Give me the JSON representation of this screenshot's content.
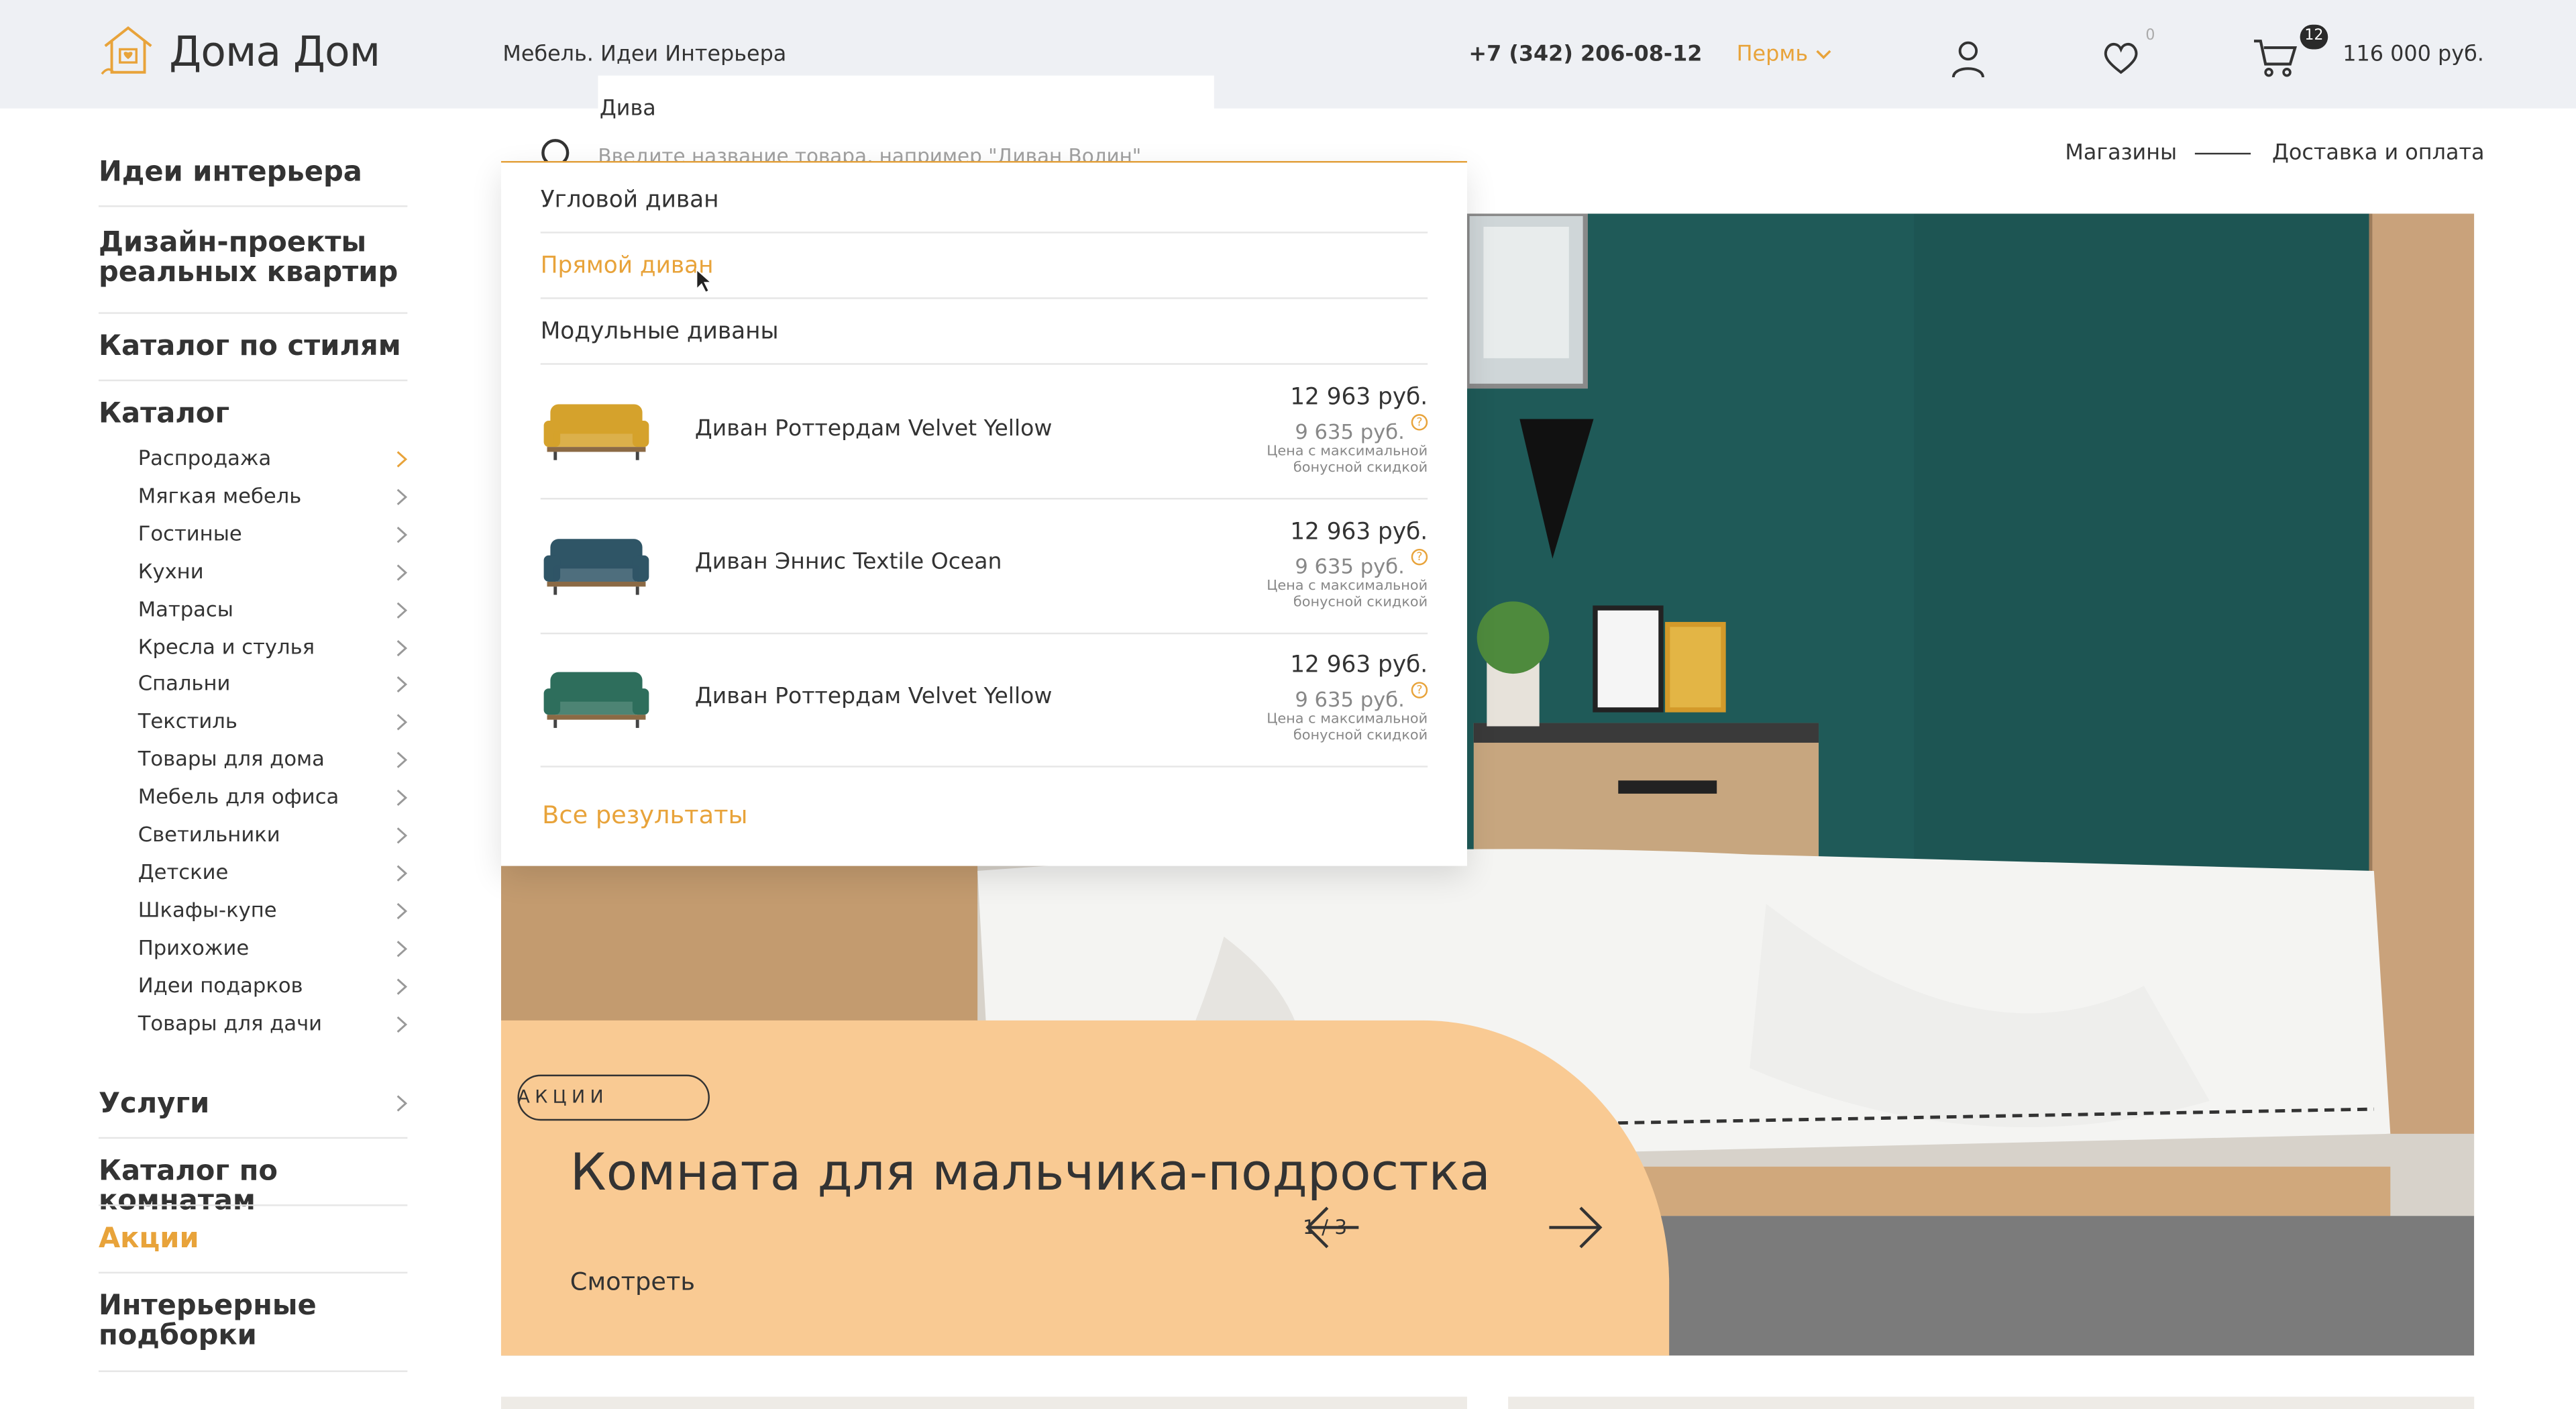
{
  "header": {
    "logo_text": "Дома Дом",
    "tagline": "Мебель. Идеи Интерьера",
    "phone": "+7 (342) 206-08-12",
    "city": "Пермь",
    "favorites_count": "0",
    "cart_count": "12",
    "cart_total": "116 000 руб."
  },
  "search": {
    "typed_text": "Дива",
    "placeholder": "Введите название товара, например \"Диван Волин\""
  },
  "dropdown": {
    "queries": [
      {
        "label": "Угловой диван"
      },
      {
        "label": "Прямой диван"
      },
      {
        "label": "Модульные диваны"
      }
    ],
    "products": [
      {
        "name": "Диван Роттердам Velvet Yellow",
        "price": "12 963 руб.",
        "bonus_price": "9 635 руб.",
        "note": "Цена с максимальной бонусной скидкой",
        "color": "#d5a22c"
      },
      {
        "name": "Диван Эннис Textile Ocean",
        "price": "12 963 руб.",
        "bonus_price": "9 635 руб.",
        "note": "Цена с максимальной бонусной скидкой",
        "color": "#2f5566"
      },
      {
        "name": "Диван Роттердам Velvet Yellow",
        "price": "12 963 руб.",
        "bonus_price": "9 635 руб.",
        "note": "Цена с максимальной бонусной скидкой",
        "color": "#2e6e5c"
      }
    ],
    "all_results": "Все результаты"
  },
  "topnav": {
    "stores": "Магазины",
    "delivery": "Доставка и оплата"
  },
  "sidebar": {
    "main_top": [
      {
        "label": "Идеи интерьера"
      },
      {
        "label": "Дизайн-проекты реальных квартир"
      },
      {
        "label": "Каталог по стилям"
      },
      {
        "label": "Каталог"
      }
    ],
    "catalog_items": [
      {
        "label": "Распродажа"
      },
      {
        "label": "Мягкая мебель"
      },
      {
        "label": "Гостиные"
      },
      {
        "label": "Кухни"
      },
      {
        "label": "Матрасы"
      },
      {
        "label": "Кресла и стулья"
      },
      {
        "label": "Спальни"
      },
      {
        "label": "Текстиль"
      },
      {
        "label": "Товары для дома"
      },
      {
        "label": "Мебель для офиса"
      },
      {
        "label": "Светильники"
      },
      {
        "label": "Детские"
      },
      {
        "label": "Шкафы-купе"
      },
      {
        "label": "Прихожие"
      },
      {
        "label": "Идеи подарков"
      },
      {
        "label": "Товары для дачи"
      }
    ],
    "main_bottom": [
      {
        "label": "Услуги"
      },
      {
        "label": "Каталог по комнатам"
      },
      {
        "label": "Акции"
      },
      {
        "label": "Интерьерные подборки"
      }
    ]
  },
  "banner": {
    "tag": "АКЦИИ",
    "title": "Комната для мальчика-подростка",
    "link": "Смотреть",
    "pagination": "1 / 3"
  },
  "colors": {
    "accent": "#e8a33a",
    "header_bg": "#eef0f4",
    "promo_bg": "#f9ca93",
    "wall": "#1f5a58"
  }
}
